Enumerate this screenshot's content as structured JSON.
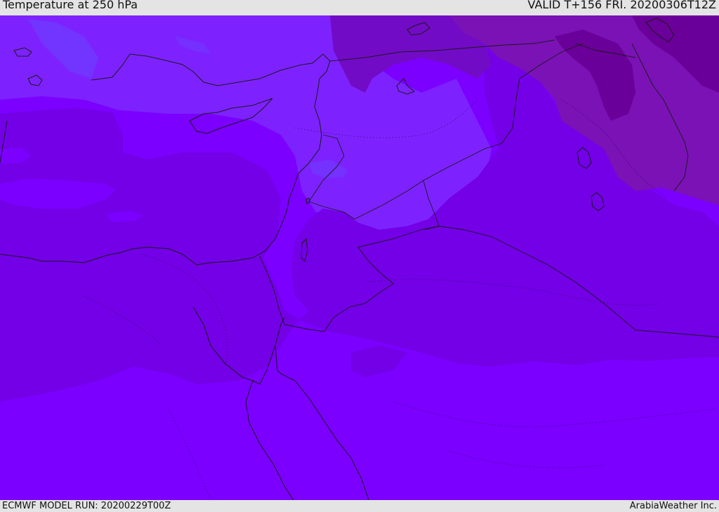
{
  "header": {
    "title": "Temperature at 250 hPa",
    "valid": "VALID T+156 FRI. 20200306T12Z"
  },
  "footer": {
    "model_run": "ECMWF MODEL RUN: 20200229T00Z",
    "credit": "ArabiaWeather Inc."
  },
  "colors": {
    "band_base": "#7b00ff",
    "band_mid": "#7300e6",
    "band_warm": "#6c00c9",
    "band_warmer": "#7a12b5",
    "band_warmest": "#6a0099",
    "band_cool": "#7d22ff",
    "band_cooler": "#6e3cff",
    "coastline": "#1a1a1a"
  }
}
